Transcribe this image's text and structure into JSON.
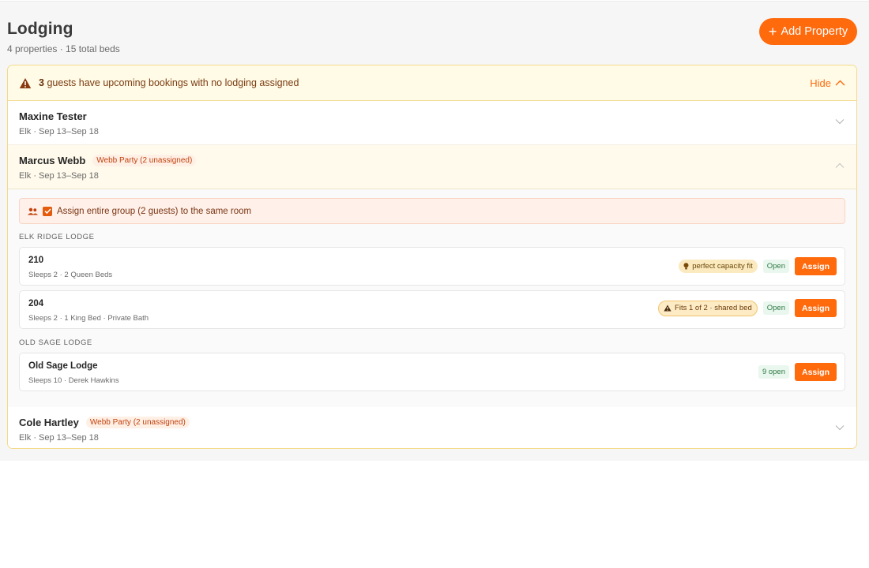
{
  "header": {
    "title": "Lodging",
    "subtitle": "4 properties · 15 total beds",
    "add_button_label": "Add Property",
    "add_button_icon": "plus-icon"
  },
  "colors": {
    "accent": "#ff6a0d",
    "alert_bg": "#fffbe6",
    "badge_text": "#c2410c",
    "open_green": "#2f7a46"
  },
  "alert": {
    "count": "3",
    "message": "guests have upcoming bookings with no lodging assigned",
    "hide_label": "Hide",
    "icon": "warning-triangle-icon"
  },
  "guests": [
    {
      "name": "Maxine Tester",
      "badge": "",
      "meta": "Elk · Sep 13–Sep 18",
      "expanded": false
    },
    {
      "name": "Marcus Webb",
      "badge": "Webb Party (2 unassigned)",
      "meta": "Elk · Sep 13–Sep 18",
      "expanded": true
    },
    {
      "name": "Cole Hartley",
      "badge": "Webb Party (2 unassigned)",
      "meta": "Elk · Sep 13–Sep 18",
      "expanded": false
    }
  ],
  "group_assign": {
    "label": "Assign entire group (2 guests) to the same room",
    "checked": true
  },
  "sections": [
    {
      "label": "ELK RIDGE LODGE",
      "rooms": [
        {
          "name": "210",
          "desc": "Sleeps 2 · 2 Queen Beds",
          "fit": "perfect capacity fit",
          "fit_icon": "lightbulb-icon",
          "status": "Open",
          "action": "Assign"
        },
        {
          "name": "204",
          "desc": "Sleeps 2 · 1 King Bed · Private Bath",
          "fit": "Fits 1 of 2 · shared bed",
          "fit_icon": "warning-triangle-icon",
          "status": "Open",
          "action": "Assign"
        }
      ]
    },
    {
      "label": "OLD SAGE LODGE",
      "rooms": [
        {
          "name": "Old Sage Lodge",
          "desc": "Sleeps 10 · Derek Hawkins",
          "fit": "",
          "status": "9 open",
          "action": "Assign"
        }
      ]
    }
  ]
}
